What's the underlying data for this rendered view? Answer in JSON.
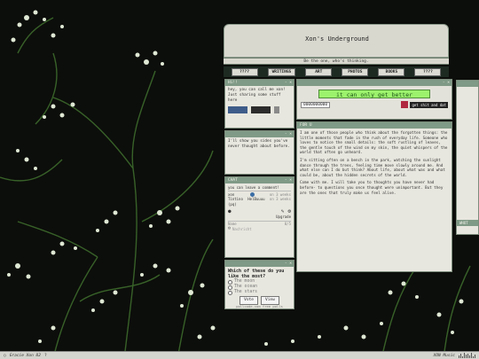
{
  "site": {
    "title": "Xon's Underground",
    "tagline": "Be the one, who's thinking.",
    "nav": [
      "????",
      "WRITINGS",
      "ART",
      "PHOTOS",
      "BOOKS",
      "????"
    ]
  },
  "hello_panel": {
    "header": "Hi!!",
    "text": "hey, you can call me xon! Just sharing some stuff here"
  },
  "about_panel": {
    "text": "I'll show you sides you've never thought about before."
  },
  "chat_panel": {
    "header": "CHAT",
    "prompt": "you can leave a comment!",
    "user": "xon",
    "time1": "on 3 weeks",
    "msg_user": "Tintino",
    "msg_text": "HelBuuuu",
    "time2": "on 3 weeks",
    "msg_tail": "(pq)",
    "name_label": "Name",
    "name_count": "0/5",
    "name_placeholder": "Nachricht",
    "upgrade": "Upgrade"
  },
  "poll": {
    "question": "Which of these do you like the most?",
    "options": [
      "The moon",
      "The ocean",
      "The stars"
    ],
    "vote": "Vote",
    "view": "View",
    "footer": "pollcode.com free polls"
  },
  "banner": {
    "text": "it can only get better",
    "counter": "0000000000",
    "tagline2": "get shit and dat"
  },
  "main_text": {
    "header": "FOR U",
    "p1": "I am one of those people who think about the forgotten things: the little moments that fade in the rush of everyday life. Someone who loves to notice the small details: the soft rustling of leaves, the gentle touch of the wind on my skin, the quiet whispers of the world that often go unheard.",
    "p2": "I'm sitting often on a bench in the park, watching the sunlight dance through the trees, feeling time move slowly around me. And what else can I do but think? About life, about what was and what could be, about the hidden secrets of the world.",
    "p3": "Come with me. I will take you to thoughts you have never had before- to questions you once thought were unimportant. But they are the ones that truly make us feel alive."
  },
  "right_strip": {
    "h2": "WHOT"
  },
  "taskbar": {
    "left": "Gracie Xon 82",
    "music": "XON Music",
    "mark": "?"
  }
}
